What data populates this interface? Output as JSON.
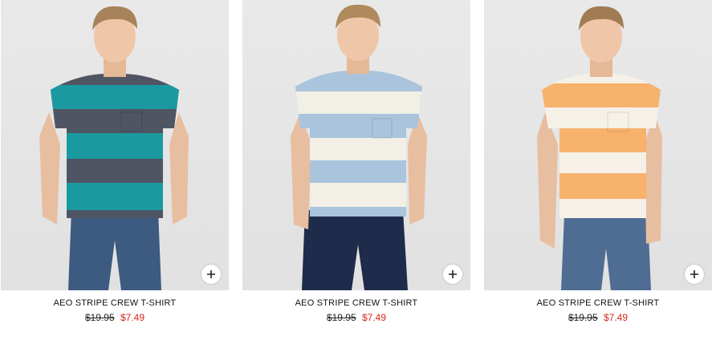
{
  "products": [
    {
      "name": "AEO STRIPE CREW T-SHIRT",
      "original_price": "$19.95",
      "sale_price": "$7.49",
      "colors": {
        "stripe_a": "#1a9aa0",
        "stripe_b": "#4f5563",
        "pants": "#3d5a80",
        "hair": "#a7835a"
      }
    },
    {
      "name": "AEO STRIPE CREW T-SHIRT",
      "original_price": "$19.95",
      "sale_price": "$7.49",
      "colors": {
        "stripe_a": "#a9c4dc",
        "stripe_b": "#f1efe6",
        "pants": "#1f2b4a",
        "hair": "#b08a5c"
      }
    },
    {
      "name": "AEO STRIPE CREW T-SHIRT",
      "original_price": "$19.95",
      "sale_price": "$7.49",
      "colors": {
        "stripe_a": "#f7b26c",
        "stripe_b": "#f6f1e8",
        "pants": "#4f6d93",
        "hair": "#a07b53"
      }
    }
  ],
  "icons": {
    "quick_add": "plus-icon"
  }
}
